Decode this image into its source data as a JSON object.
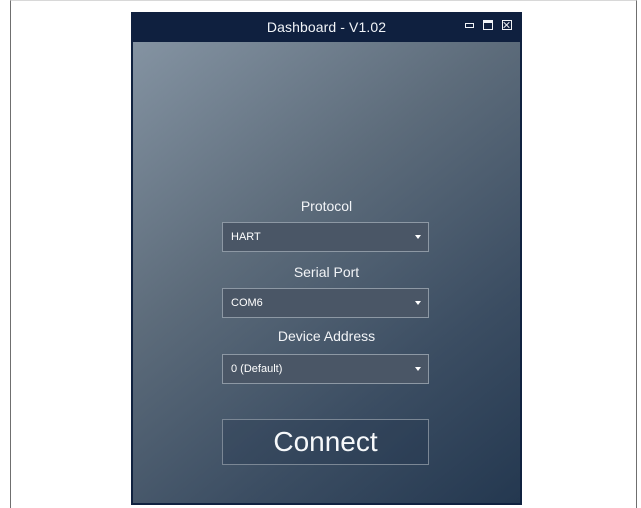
{
  "window": {
    "title": "Dashboard - V1.02"
  },
  "form": {
    "protocol": {
      "label": "Protocol",
      "value": "HART"
    },
    "serial_port": {
      "label": "Serial Port",
      "value": "COM6"
    },
    "device_address": {
      "label": "Device Address",
      "value": "0 (Default)"
    },
    "connect_label": "Connect"
  },
  "icons": {
    "minimize": "minimize-icon",
    "maximize": "maximize-icon",
    "close": "close-icon",
    "dropdown": "chevron-down-icon"
  },
  "colors": {
    "titlebar": "#0f203f",
    "gradient_light": "#8493a2",
    "gradient_dark": "#243850",
    "select_background": "#4a5666"
  }
}
